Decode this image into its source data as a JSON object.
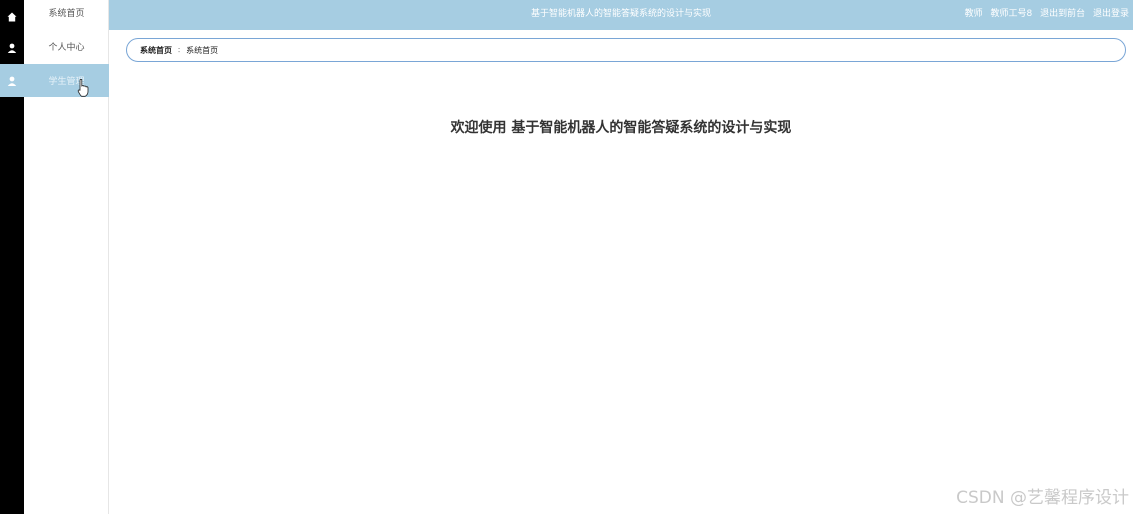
{
  "rail_icons": [
    "home-icon",
    "user-icon",
    "user-icon"
  ],
  "sidebar": {
    "items": [
      {
        "label": "系统首页"
      },
      {
        "label": "个人中心"
      },
      {
        "label": "学生管理"
      }
    ]
  },
  "topbar": {
    "title": "基于智能机器人的智能答疑系统的设计与实现",
    "role": "教师",
    "user": "教师工号8",
    "exit_backend": "退出到前台",
    "logout": "退出登录"
  },
  "breadcrumb": {
    "home": "系统首页",
    "separator": "∶",
    "current": "系统首页"
  },
  "welcome": "欢迎使用 基于智能机器人的智能答疑系统的设计与实现",
  "watermark": "CSDN @艺馨程序设计",
  "colors": {
    "accent": "#a6cde2",
    "rail": "#000000",
    "border": "#7aa6d6"
  }
}
